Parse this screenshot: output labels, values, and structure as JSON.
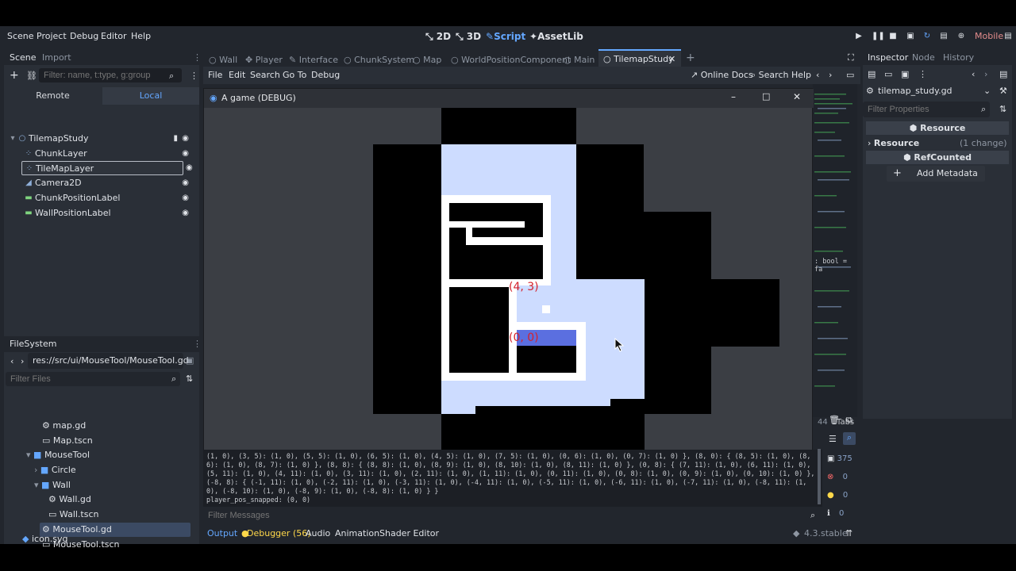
{
  "menu": {
    "scene": "Scene",
    "project": "Project",
    "debug": "Debug",
    "editor": "Editor",
    "help": "Help"
  },
  "modes": {
    "m2d": "2D",
    "m3d": "3D",
    "script": "Script",
    "assetlib": "AssetLib"
  },
  "renderer": "Mobile",
  "scene_dock": {
    "tab_scene": "Scene",
    "tab_import": "Import",
    "filter_placeholder": "Filter: name, t:type, g:group",
    "remote": "Remote",
    "local": "Local",
    "nodes": [
      {
        "label": "TilemapStudy"
      },
      {
        "label": "ChunkLayer"
      },
      {
        "label": "TileMapLayer"
      },
      {
        "label": "Camera2D"
      },
      {
        "label": "ChunkPositionLabel"
      },
      {
        "label": "WallPositionLabel"
      }
    ]
  },
  "filesystem": {
    "tab": "FileSystem",
    "path": "res://src/ui/MouseTool/MouseTool.gd",
    "filter_placeholder": "Filter Files",
    "items": [
      {
        "label": "map.gd"
      },
      {
        "label": "Map.tscn"
      },
      {
        "label": "MouseTool"
      },
      {
        "label": "Circle"
      },
      {
        "label": "Wall"
      },
      {
        "label": "Wall.gd"
      },
      {
        "label": "Wall.tscn"
      },
      {
        "label": "MouseTool.gd"
      },
      {
        "label": "MouseTool.tscn"
      },
      {
        "label": "icon.svg"
      }
    ]
  },
  "script_tabs": [
    "Wall",
    "Player",
    "Interface",
    "ChunkSystem",
    "Map",
    "WorldPositionComponent",
    "Main",
    "TilemapStudy"
  ],
  "code_menu": {
    "file": "File",
    "edit": "Edit",
    "search": "Search",
    "goto": "Go To",
    "debug": "Debug",
    "online_docs": "Online Docs",
    "search_help": "Search Help"
  },
  "game_window": {
    "title": "A game (DEBUG)",
    "label_a": "(4, 3)",
    "label_b": "(0, 0)"
  },
  "code_peek": {
    "snippet": ": bool = fa",
    "line_col": "44",
    "indent": "Tabs"
  },
  "inspector": {
    "tab_inspector": "Inspector",
    "tab_node": "Node",
    "tab_history": "History",
    "file": "tilemap_study.gd",
    "filter_placeholder": "Filter Properties",
    "section_resource": "Resource",
    "resource_row": "Resource",
    "resource_changes": "(1 change)",
    "section_refcounted": "RefCounted",
    "add_metadata": "Add Metadata"
  },
  "output": {
    "text": "(1, 0), (3, 5): (1, 0), (5, 5): (1, 0), (6, 5): (1, 0), (4, 5): (1, 0), (7, 5): (1, 0), (0, 6): (1, 0), (0, 7): (1, 0) }, (8, 0): { (8, 5): (1, 0), (8, 6): (1, 0), (8, 7): (1, 0) }, (8, 8): { (8, 8): (1, 0), (8, 9): (1, 0), (8, 10): (1, 0), (8, 11): (1, 0) }, (0, 8): { (7, 11): (1, 0), (6, 11): (1, 0), (5, 11): (1, 0), (4, 11): (1, 0), (3, 11): (1, 0), (2, 11): (1, 0), (1, 11): (1, 0), (0, 11): (1, 0), (0, 8): (1, 0), (0, 9): (1, 0), (0, 10): (1, 0) }, (-8, 8): { (-1, 11): (1, 0), (-2, 11): (1, 0), (-3, 11): (1, 0), (-4, 11): (1, 0), (-5, 11): (1, 0), (-6, 11): (1, 0), (-7, 11): (1, 0), (-8, 11): (1, 0), (-8, 10): (1, 0), (-8, 9): (1, 0), (-8, 8): (1, 0) } }\nplayer_pos_snapped: (0, 0)",
    "filter_placeholder": "Filter Messages",
    "count_messages": "375",
    "count_errors": "0",
    "count_warnings": "0",
    "count_info": "0"
  },
  "bottom_tabs": {
    "output": "Output",
    "debugger": "Debugger (56)",
    "audio": "Audio",
    "animation": "Animation",
    "shader": "Shader Editor"
  },
  "version": "4.3.stable",
  "colors": {
    "accent": "#64a7ff",
    "error": "#ff6b6b",
    "warning": "#ffd84a",
    "label_red": "#d5212b",
    "floor": "#cddcff",
    "selection": "#5b6fe0"
  }
}
